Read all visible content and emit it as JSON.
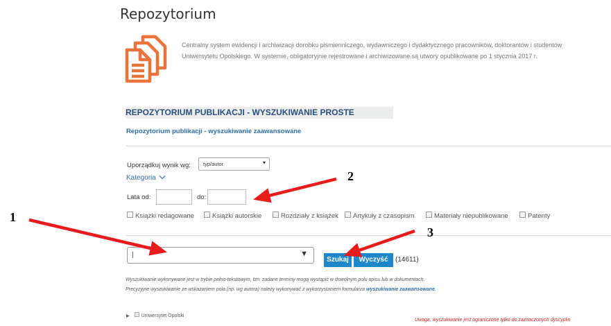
{
  "page": {
    "title": "Repozytorium",
    "intro_line1": "Centralny system ewidencji i archiwizacji dorobku piśmienniczego, wydawniczego i dydaktycznego pracowników, doktorantów i studentów",
    "intro_line2": "Uniwersytetu Opolskiego. W systemie, obligatoryjnie rejestrowane i archiwizowane są utwory opublikowane po 1 stycznia 2017 r.",
    "icon": "documents-icon",
    "accent_color": "#e8743b"
  },
  "search": {
    "heading": "REPOZYTORIUM PUBLIKACJI - WYSZUKIWANIE PROSTE",
    "advanced_link": "Repozytorium publikacji - wyszukiwanie zaawansowane",
    "sort_label": "Uporządkuj wynik wg:",
    "sort_value": "typ/autor",
    "category_label": "Kategoria",
    "years_from_label": "Lata od:",
    "years_to_label": "do:",
    "years_from_value": "",
    "years_to_value": "",
    "categories": [
      "Książki redagowane",
      "Książki autorskie",
      "Rozdziały z książek",
      "Artykuły z czasopism",
      "Materiały niepublikowane",
      "Patenty"
    ],
    "main_select_value": "|",
    "search_button": "Szukaj",
    "clear_button": "Wyczyść",
    "result_count": "(14611)",
    "note1": "Wyszukiwanie wykonywane jest w trybie pełno-tekstowym, tzn. zadane terminy mogą wystąpić w dowolnym polu opisu lub w dokumentach.",
    "note2_prefix": "Precyzyjne wyszukiwanie ze wskazaniem pola (np. wg autora) należy wykonywać z wykorzystaniem formularza ",
    "note2_link": "wyszukiwanie zaawansowane",
    "note2_suffix": ".",
    "tree_item": "Uniwersytet Opolski",
    "warning": "Uwaga: wyszukiwanie jest ograniczone tylko do zaznaczonych dyscyplin"
  },
  "annotations": {
    "label_1": "1",
    "label_2": "2",
    "label_3": "3",
    "arrow_color": "#e81c1c"
  }
}
